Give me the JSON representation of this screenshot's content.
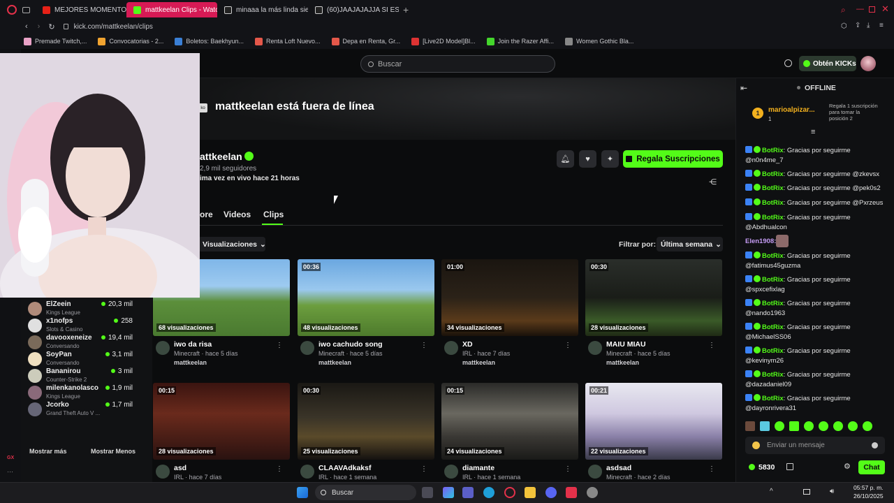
{
  "browser": {
    "tabs": [
      {
        "label": "MEJORES MOMENTOS D",
        "color": "#e62117"
      },
      {
        "label": "mattkeelan Clips - Watch",
        "color": "#53fc18"
      },
      {
        "label": "minaaa la más linda siem",
        "color": "#ffffff"
      },
      {
        "label": "(60)JAAJAJAJJA SI ES",
        "color": "#ffffff"
      }
    ],
    "url": "kick.com/mattkeelan/clips",
    "bookmarks": [
      "Premade Twitch,...",
      "Convocatorias - 2...",
      "Boletos: Baekhyun...",
      "Renta Loft Nuevo...",
      "Depa en Renta, Gr...",
      "[Live2D Model]Bl...",
      "Join the Razer Affi...",
      "Women Gothic Bla..."
    ]
  },
  "header": {
    "search_placeholder": "Buscar",
    "kicks_label": "Obtén KICKs"
  },
  "channel": {
    "offline_title": "mattkeelan está fuera de línea",
    "name": "attkeelan",
    "followers": "2,9 mil seguidores",
    "last_live": "ima vez en vivo hace 21 horas",
    "subscribe_label": "Regala Suscripciones",
    "tabs": [
      "ore",
      "Videos",
      "Clips"
    ],
    "sort_label": "Visualizaciones",
    "filter_label": "Filtrar por:",
    "filter_value": "Última semana"
  },
  "sidebar": {
    "streamers": [
      {
        "name": "ElZeein",
        "game": "Kings League",
        "viewers": "20,3 mil"
      },
      {
        "name": "x1nofps",
        "game": "Slots & Casino",
        "viewers": "258"
      },
      {
        "name": "davooxeneize",
        "game": "Conversando",
        "viewers": "19,4 mil"
      },
      {
        "name": "SoyPan",
        "game": "Conversando",
        "viewers": "3,1 mil"
      },
      {
        "name": "Bananirou",
        "game": "Counter-Strike 2",
        "viewers": "3 mil"
      },
      {
        "name": "milenkanolasco",
        "game": "Kings League",
        "viewers": "1,9 mil"
      },
      {
        "name": "Jcorko",
        "game": "Grand Theft Auto V ...",
        "viewers": "1,7 mil"
      }
    ],
    "show_more": "Mostrar más",
    "show_less": "Mostrar Menos"
  },
  "clips": [
    {
      "duration": "",
      "views": "68 visualizaciones",
      "title": "iwo da risa",
      "meta": "Minecraft · hace 5 días",
      "user": "mattkeelan"
    },
    {
      "duration": "00:36",
      "views": "48 visualizaciones",
      "title": "iwo cachudo song",
      "meta": "Minecraft · hace 5 días",
      "user": "mattkeelan"
    },
    {
      "duration": "01:00",
      "views": "34 visualizaciones",
      "title": "XD",
      "meta": "IRL · hace 7 días",
      "user": "mattkeelan"
    },
    {
      "duration": "00:30",
      "views": "28 visualizaciones",
      "title": "MAIU MIAU",
      "meta": "Minecraft · hace 5 días",
      "user": "mattkeelan"
    },
    {
      "duration": "00:15",
      "views": "28 visualizaciones",
      "title": "asd",
      "meta": "IRL · hace 7 días",
      "user": ""
    },
    {
      "duration": "00:30",
      "views": "25 visualizaciones",
      "title": "CLAAVAdkaksf",
      "meta": "IRL · hace 1 semana",
      "user": ""
    },
    {
      "duration": "00:15",
      "views": "24 visualizaciones",
      "title": "diamante",
      "meta": "IRL · hace 1 semana",
      "user": ""
    },
    {
      "duration": "00:21",
      "views": "22 visualizaciones",
      "title": "asdsad",
      "meta": "Minecraft · hace 2 días",
      "user": ""
    }
  ],
  "chat": {
    "status": "OFFLINE",
    "top_user": "marioalpizar...",
    "top_count": "1",
    "gift_note": "Regala 1 suscripción para tomar la posición 2",
    "bot_name": "BotRix",
    "bot_text": "Gracias por seguirme",
    "messages": [
      "@n0n4me_7",
      "@zkevsx",
      "@pek0s2",
      "@Pxrzeus",
      "@Abdhualcon",
      "@fatimus45guzma",
      "@spxcefixlag",
      "@nando1963",
      "@MichaelSS06",
      "@kevinym26",
      "@dazadaniel09",
      "@dayronrivera31"
    ],
    "elen_user": "Elen1908:",
    "input_placeholder": "Enviar un mensaje",
    "points": "5830",
    "chat_button": "Chat"
  },
  "taskbar": {
    "search": "Buscar",
    "time": "05:57 p. m.",
    "date": "26/10/2025"
  }
}
